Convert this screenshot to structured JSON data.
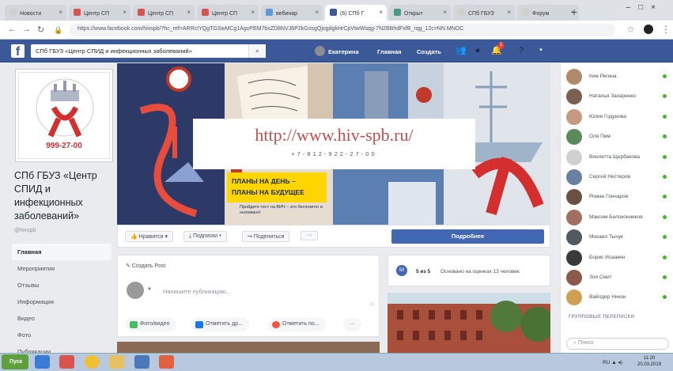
{
  "browser": {
    "tabs": [
      {
        "label": "Новости",
        "color": "#cfcfcf"
      },
      {
        "label": "Центр СП",
        "color": "#d9534f"
      },
      {
        "label": "Центр СП",
        "color": "#d9534f"
      },
      {
        "label": "Центр СП",
        "color": "#d9534f"
      },
      {
        "label": "вебинар",
        "color": "#5b9bd5"
      },
      {
        "label": "(6) СПб Г",
        "color": "#3b5998"
      },
      {
        "label": "Открыт",
        "color": "#4a9a8a"
      },
      {
        "label": "СПб ГБУЗ",
        "color": "#cfcfcf"
      },
      {
        "label": "Форум",
        "color": "#cfcfcf"
      }
    ],
    "url": "https://www.facebook.com/hivspb/?hc_ref=ARRcIYQgTGSwMCg1AgvPEM7bxZD8NVJ6P2kGosgQjogdgkHrCpVtwWsqg-7N2BBhdFxfB_rqg_12c=NN.MNOC",
    "icons": {
      "back": "back-arrow-icon",
      "forward": "forward-arrow-icon",
      "reload": "reload-icon",
      "lock": "lock-icon",
      "star": "star-icon",
      "menu": "menu-icon"
    }
  },
  "fb": {
    "search_value": "СПб ГБУЗ «Центр СПИД и инфекционных заболеваний»",
    "user_name": "Екатерина",
    "nav_home": "Главная",
    "nav_create": "Создать",
    "notif_count": "1"
  },
  "page": {
    "name": "СПб ГБУЗ «Центр СПИД и инфекционных заболеваний»",
    "handle": "@hivspb",
    "logo_phone": "999-27-00",
    "nav": [
      "Главная",
      "Мероприятия",
      "Отзывы",
      "Информация",
      "Видео",
      "Фото",
      "Публикации"
    ]
  },
  "cover": {
    "url_text": "http://www.hiv-spb.ru/",
    "phone_text": "+7-812-922-27-00",
    "plany_line1": "ПЛАНЫ НА ДЕНЬ –",
    "plany_line2": "ПЛАНЫ НА БУДУЩЕЕ",
    "plany_sub": "Пройдите тест на ВИЧ – это бесплатно и анонимно!"
  },
  "actions": {
    "like": "Нравится",
    "follow": "Подписки",
    "share": "Поделиться",
    "more": "···",
    "details": "Подробнее"
  },
  "composer": {
    "header": "Создать Post",
    "placeholder": "Напишите публикацию...",
    "btn_photo": "Фото/видео",
    "btn_tag": "Отметить др...",
    "btn_checkin": "Отметить по...",
    "btn_more": "···"
  },
  "rightbox": {
    "badge": "50",
    "title": "5 из 5",
    "subtitle": "Основано на оценках 13 человек"
  },
  "friends": [
    {
      "name": "Ким Регина",
      "color": "#b08a6a"
    },
    {
      "name": "Наталья Захаренко",
      "color": "#7a6050"
    },
    {
      "name": "Юлия Годунова",
      "color": "#c49a80"
    },
    {
      "name": "Оля Пим",
      "color": "#5a8a5a"
    },
    {
      "name": "Виолетта Щербакова",
      "color": "#d0d0d0"
    },
    {
      "name": "Сергей Нестеров",
      "color": "#6a80a0"
    },
    {
      "name": "Роман Гончаров",
      "color": "#6a5040"
    },
    {
      "name": "Максим Белоконников",
      "color": "#a07060"
    },
    {
      "name": "Михаил Тычук",
      "color": "#505a60"
    },
    {
      "name": "Борис Исаакян",
      "color": "#3a3a3a"
    },
    {
      "name": "Зоя Смит",
      "color": "#8a5a4a"
    },
    {
      "name": "Вайлдер Никон",
      "color": "#d0a050"
    }
  ],
  "groups_label": "ГРУППОВЫЕ ПЕРЕПИСКИ",
  "right_search": "Поиск",
  "taskbar": {
    "start_label": "Пуск",
    "lang": "RU",
    "time": "11:20",
    "date": "20.03.2018"
  }
}
